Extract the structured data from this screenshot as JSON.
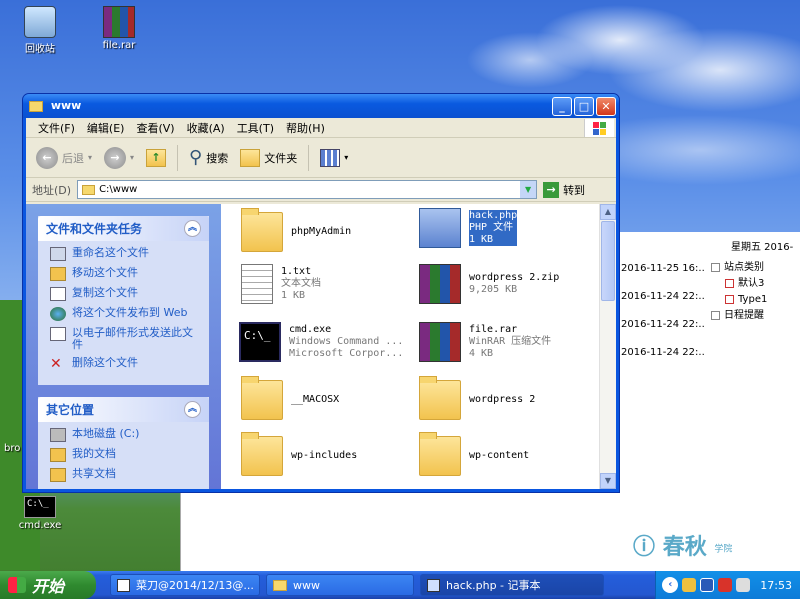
{
  "desktop": {
    "recycle_bin": "回收站",
    "file_rar": "file.rar",
    "cmd": "cmd.exe",
    "bro": "bro"
  },
  "bg_window": {
    "header": "星期五  2016-",
    "dates": [
      "2016-11-25 16:..",
      "2016-11-24 22:..",
      "2016-11-24 22:..",
      "2016-11-24 22:.."
    ],
    "tree": [
      "站点类别",
      "默认3",
      "Type1",
      "日程提醒"
    ]
  },
  "brand": {
    "name": "春秋",
    "sub": "学院"
  },
  "explorer": {
    "title": "www",
    "menu": [
      "文件(F)",
      "编辑(E)",
      "查看(V)",
      "收藏(A)",
      "工具(T)",
      "帮助(H)"
    ],
    "toolbar": {
      "back": "后退",
      "search": "搜索",
      "folders": "文件夹"
    },
    "address": {
      "label": "地址(D)",
      "value": "C:\\www",
      "go": "转到"
    },
    "tasks": {
      "title": "文件和文件夹任务",
      "items": [
        "重命名这个文件",
        "移动这个文件",
        "复制这个文件",
        "将这个文件发布到 Web",
        "以电子邮件形式发送此文件",
        "删除这个文件"
      ]
    },
    "places": {
      "title": "其它位置",
      "items": [
        "本地磁盘 (C:)",
        "我的文档",
        "共享文档"
      ]
    },
    "files": [
      {
        "name": "phpMyAdmin",
        "l2": "",
        "l3": "",
        "icon": "folder-icon"
      },
      {
        "name": "hack.php",
        "l2": "PHP 文件",
        "l3": "1 KB",
        "icon": "php-file-icon"
      },
      {
        "name": "1.txt",
        "l2": "文本文档",
        "l3": "1 KB",
        "icon": "text-file-icon"
      },
      {
        "name": "wordpress 2.zip",
        "l2": "9,205 KB",
        "l3": "",
        "icon": "rar-archive-icon"
      },
      {
        "name": "cmd.exe",
        "l2": "Windows Command ...",
        "l3": "Microsoft Corpor...",
        "icon": "cmd-icon"
      },
      {
        "name": "file.rar",
        "l2": "WinRAR 压缩文件",
        "l3": "4 KB",
        "icon": "rar-archive-icon"
      },
      {
        "name": "__MACOSX",
        "l2": "",
        "l3": "",
        "icon": "folder-icon"
      },
      {
        "name": "wordpress 2",
        "l2": "",
        "l3": "",
        "icon": "folder-icon"
      },
      {
        "name": "wp-includes",
        "l2": "",
        "l3": "",
        "icon": "folder-icon"
      },
      {
        "name": "wp-content",
        "l2": "",
        "l3": "",
        "icon": "folder-icon"
      }
    ]
  },
  "taskbar": {
    "start": "开始",
    "tasks": [
      "菜刀@2014/12/13@...",
      "www",
      "hack.php - 记事本"
    ],
    "clock": "17:53"
  },
  "colors": {
    "xp_blue": "#0a56e0",
    "selection": "#316ac5",
    "task_link": "#215dc6"
  }
}
